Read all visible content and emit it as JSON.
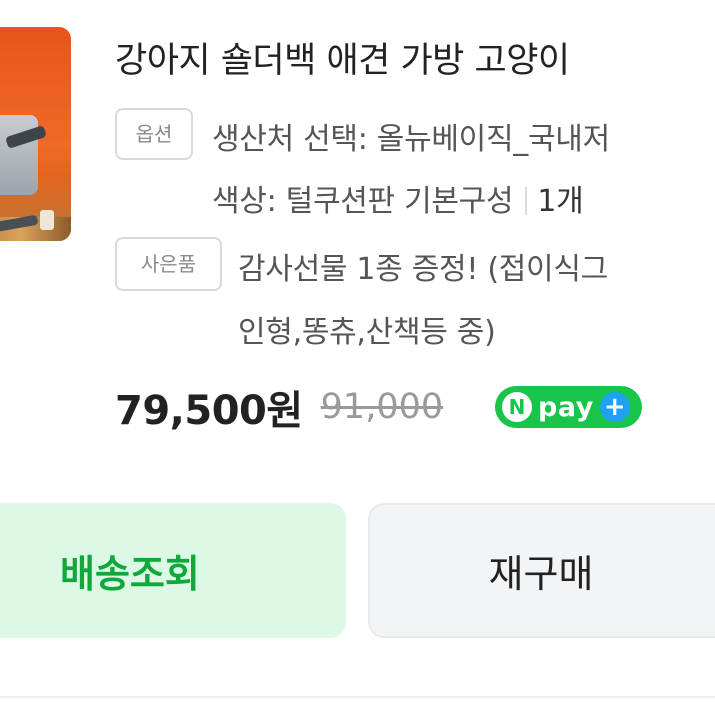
{
  "product": {
    "title": "강아지 숄더백 애견 가방 고양이",
    "option_tag": "옵션",
    "option_line1": "생산처 선택: 올뉴베이직_국내저",
    "option_line2": "색상: 털쿠션판 기본구성",
    "quantity": "1개",
    "gift_tag": "사은품",
    "gift_line1": "감사선물 1종 증정! (접이식그",
    "gift_line2": "인형,똥츄,산책등 중)",
    "price": "79,500원",
    "original_price": "91,000",
    "npay": {
      "n": "N",
      "pay": "pay",
      "plus": "+"
    }
  },
  "actions": {
    "track_label": "배송조회",
    "reorder_label": "재구매"
  },
  "colors": {
    "accent_green": "#10a83a",
    "track_bg": "#dcf9e5",
    "npay_green": "#19c44b",
    "npay_blue": "#1fa0f5"
  }
}
